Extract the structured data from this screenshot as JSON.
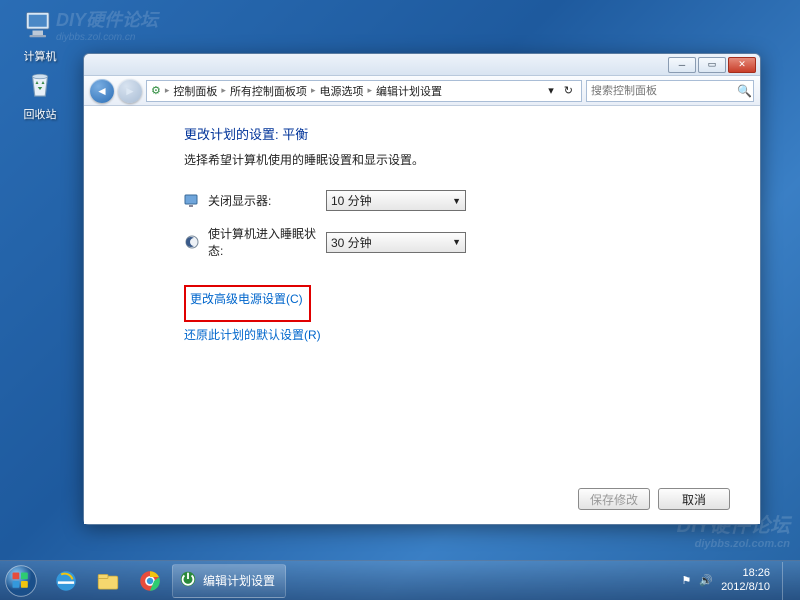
{
  "desktop": {
    "computer_label": "计算机",
    "recycle_label": "回收站"
  },
  "watermark": {
    "title": "DIY硬件论坛",
    "sub": "diybbs.zol.com.cn"
  },
  "window": {
    "breadcrumb": {
      "b0": "控制面板",
      "b1": "所有控制面板项",
      "b2": "电源选项",
      "b3": "编辑计划设置"
    },
    "search_placeholder": "搜索控制面板",
    "heading": "更改计划的设置: 平衡",
    "description": "选择希望计算机使用的睡眠设置和显示设置。",
    "display_off_label": "关闭显示器:",
    "display_off_value": "10 分钟",
    "sleep_label": "使计算机进入睡眠状态:",
    "sleep_value": "30 分钟",
    "advanced_link": "更改高级电源设置(C)",
    "restore_link": "还原此计划的默认设置(R)",
    "save_label": "保存修改",
    "cancel_label": "取消"
  },
  "taskbar": {
    "active_label": "编辑计划设置",
    "time": "18:26",
    "date": "2012/8/10"
  }
}
